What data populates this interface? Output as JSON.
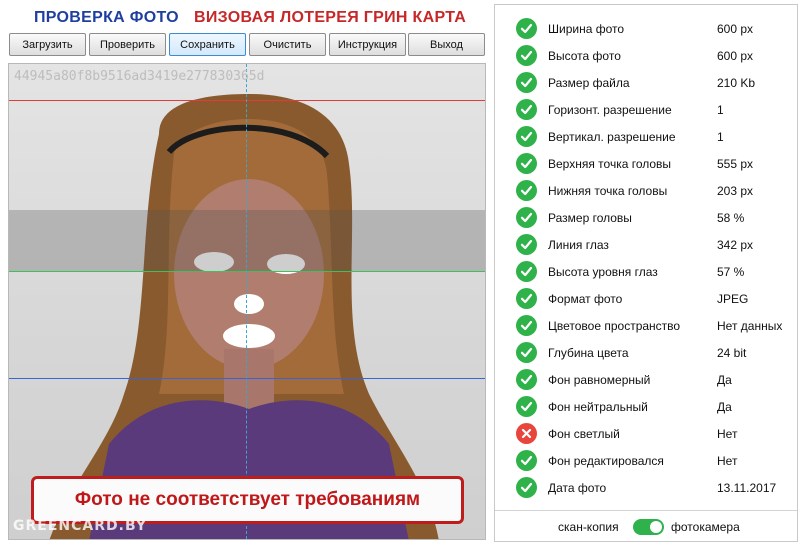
{
  "header": {
    "title_left": "ПРОВЕРКА ФОТО",
    "title_right": "ВИЗОВАЯ ЛОТЕРЕЯ ГРИН КАРТА",
    "title_left_color": "#1f3f9f",
    "title_right_color": "#c62828"
  },
  "toolbar": {
    "load": "Загрузить",
    "check": "Проверить",
    "save": "Сохранить",
    "clear": "Очистить",
    "instruction": "Инструкция",
    "exit": "Выход"
  },
  "photo": {
    "hash": "44945a80f8b9516ad3419e277830365d",
    "warning": "Фото не соответствует требованиям",
    "watermark": "GREENCARD.BY",
    "guide_colors": {
      "top": "#e03c3c",
      "eyes": "#3bc25a",
      "bottom": "#3a63d6",
      "center": "#3aa6c9"
    }
  },
  "checks": [
    {
      "label": "Ширина фото",
      "value": "600 px",
      "status": "ok"
    },
    {
      "label": "Высота фото",
      "value": "600 px",
      "status": "ok"
    },
    {
      "label": "Размер файла",
      "value": "210 Kb",
      "status": "ok"
    },
    {
      "label": "Горизонт. разрешение",
      "value": "1",
      "status": "ok"
    },
    {
      "label": "Вертикал. разрешение",
      "value": "1",
      "status": "ok"
    },
    {
      "label": "Верхняя точка головы",
      "value": "555 px",
      "status": "ok"
    },
    {
      "label": "Нижняя точка головы",
      "value": "203 px",
      "status": "ok"
    },
    {
      "label": "Размер головы",
      "value": "58 %",
      "status": "ok"
    },
    {
      "label": "Линия глаз",
      "value": "342 px",
      "status": "ok"
    },
    {
      "label": "Высота уровня глаз",
      "value": "57 %",
      "status": "ok"
    },
    {
      "label": "Формат фото",
      "value": "JPEG",
      "status": "ok"
    },
    {
      "label": "Цветовое пространство",
      "value": "Нет данных",
      "status": "ok"
    },
    {
      "label": "Глубина цвета",
      "value": "24 bit",
      "status": "ok"
    },
    {
      "label": "Фон равномерный",
      "value": "Да",
      "status": "ok"
    },
    {
      "label": "Фон нейтральный",
      "value": "Да",
      "status": "ok"
    },
    {
      "label": "Фон светлый",
      "value": "Нет",
      "status": "fail"
    },
    {
      "label": "Фон редактировался",
      "value": "Нет",
      "status": "ok"
    },
    {
      "label": "Дата фото",
      "value": "13.11.2017",
      "status": "ok"
    }
  ],
  "source_toggle": {
    "left_label": "скан-копия",
    "right_label": "фотокамера",
    "selected": "фотокамера"
  },
  "colors": {
    "ok": "#30b24a",
    "fail": "#e8453c",
    "warning_border": "#bf1d1d"
  }
}
